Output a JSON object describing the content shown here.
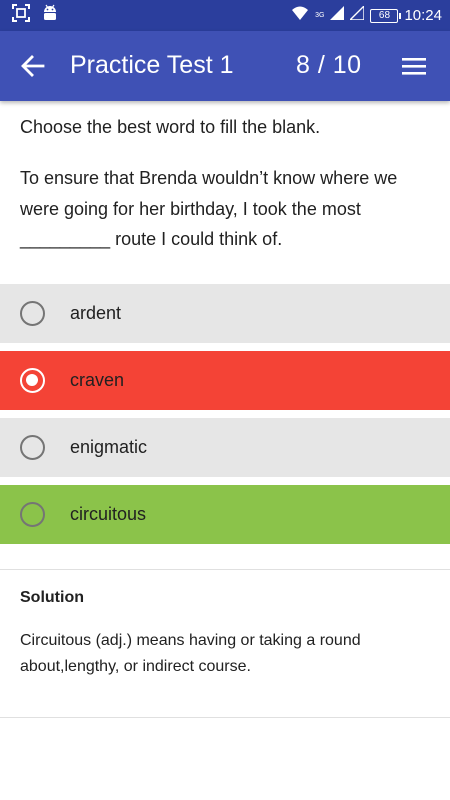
{
  "status_bar": {
    "net_label": "3G",
    "battery": "68",
    "time": "10:24"
  },
  "app_bar": {
    "title": "Practice Test 1",
    "progress": "8  / 10"
  },
  "question": {
    "instruction": "Choose the best word to fill the blank.",
    "text": "To ensure that Brenda wouldn’t know where we were going for her birthday, I took the most _________ route I could think of."
  },
  "options": [
    {
      "label": "ardent",
      "state": "neutral",
      "bg": "#e6e6e6",
      "selected": false
    },
    {
      "label": "craven",
      "state": "incorrect-selected",
      "bg": "#f44336",
      "selected": true
    },
    {
      "label": "enigmatic",
      "state": "neutral",
      "bg": "#e6e6e6",
      "selected": false
    },
    {
      "label": "circuitous",
      "state": "correct",
      "bg": "#8bc34a",
      "selected": false
    }
  ],
  "solution": {
    "heading": "Solution",
    "text": "Circuitous (adj.) means having or taking a round about,lengthy, or indirect course."
  },
  "colors": {
    "status_bar": "#2b3e9d",
    "app_bar": "#3f51b5",
    "option_neutral": "#e6e6e6",
    "option_incorrect": "#f44336",
    "option_correct": "#8bc34a"
  },
  "icons": {
    "status_left": [
      "screenshot-icon",
      "android-icon"
    ],
    "status_right": [
      "wifi-icon",
      "signal-icon",
      "signal-icon-2",
      "battery-icon"
    ],
    "app_bar": [
      "back-arrow-icon",
      "hamburger-menu-icon"
    ]
  }
}
